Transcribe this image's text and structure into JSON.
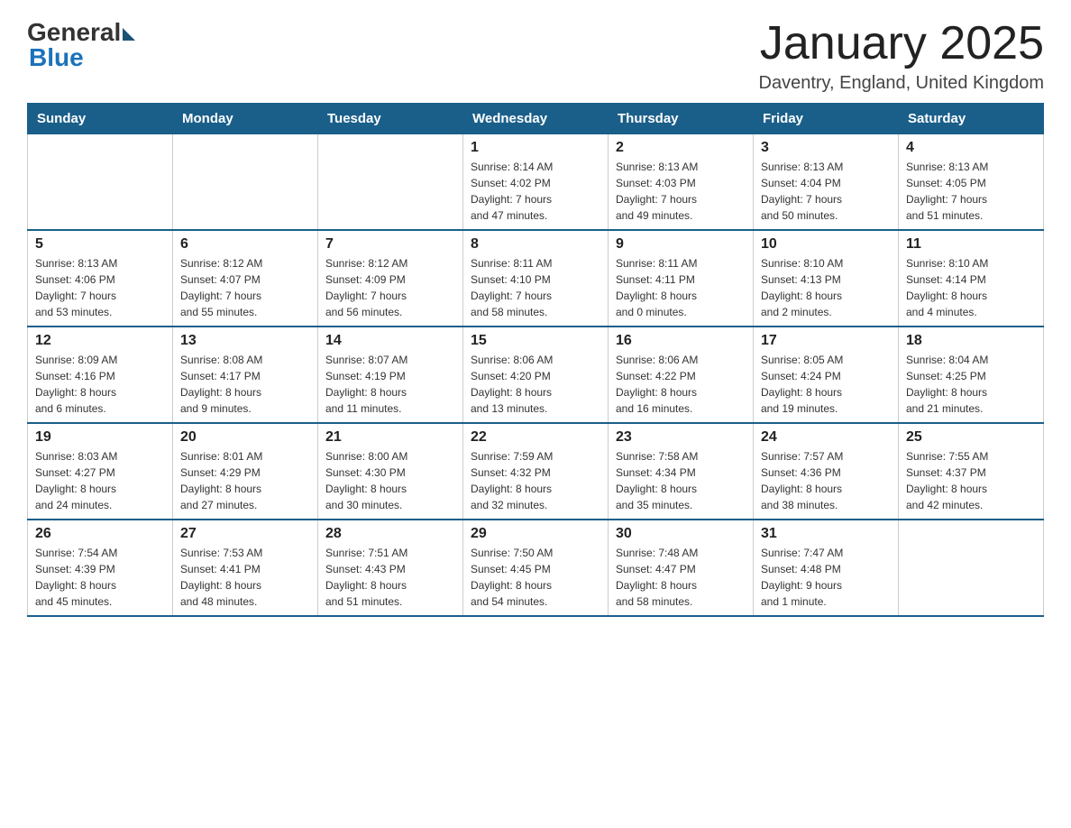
{
  "header": {
    "logo_general": "General",
    "logo_blue": "Blue",
    "title": "January 2025",
    "subtitle": "Daventry, England, United Kingdom"
  },
  "days_of_week": [
    "Sunday",
    "Monday",
    "Tuesday",
    "Wednesday",
    "Thursday",
    "Friday",
    "Saturday"
  ],
  "weeks": [
    {
      "days": [
        {
          "num": "",
          "info": ""
        },
        {
          "num": "",
          "info": ""
        },
        {
          "num": "",
          "info": ""
        },
        {
          "num": "1",
          "info": "Sunrise: 8:14 AM\nSunset: 4:02 PM\nDaylight: 7 hours\nand 47 minutes."
        },
        {
          "num": "2",
          "info": "Sunrise: 8:13 AM\nSunset: 4:03 PM\nDaylight: 7 hours\nand 49 minutes."
        },
        {
          "num": "3",
          "info": "Sunrise: 8:13 AM\nSunset: 4:04 PM\nDaylight: 7 hours\nand 50 minutes."
        },
        {
          "num": "4",
          "info": "Sunrise: 8:13 AM\nSunset: 4:05 PM\nDaylight: 7 hours\nand 51 minutes."
        }
      ]
    },
    {
      "days": [
        {
          "num": "5",
          "info": "Sunrise: 8:13 AM\nSunset: 4:06 PM\nDaylight: 7 hours\nand 53 minutes."
        },
        {
          "num": "6",
          "info": "Sunrise: 8:12 AM\nSunset: 4:07 PM\nDaylight: 7 hours\nand 55 minutes."
        },
        {
          "num": "7",
          "info": "Sunrise: 8:12 AM\nSunset: 4:09 PM\nDaylight: 7 hours\nand 56 minutes."
        },
        {
          "num": "8",
          "info": "Sunrise: 8:11 AM\nSunset: 4:10 PM\nDaylight: 7 hours\nand 58 minutes."
        },
        {
          "num": "9",
          "info": "Sunrise: 8:11 AM\nSunset: 4:11 PM\nDaylight: 8 hours\nand 0 minutes."
        },
        {
          "num": "10",
          "info": "Sunrise: 8:10 AM\nSunset: 4:13 PM\nDaylight: 8 hours\nand 2 minutes."
        },
        {
          "num": "11",
          "info": "Sunrise: 8:10 AM\nSunset: 4:14 PM\nDaylight: 8 hours\nand 4 minutes."
        }
      ]
    },
    {
      "days": [
        {
          "num": "12",
          "info": "Sunrise: 8:09 AM\nSunset: 4:16 PM\nDaylight: 8 hours\nand 6 minutes."
        },
        {
          "num": "13",
          "info": "Sunrise: 8:08 AM\nSunset: 4:17 PM\nDaylight: 8 hours\nand 9 minutes."
        },
        {
          "num": "14",
          "info": "Sunrise: 8:07 AM\nSunset: 4:19 PM\nDaylight: 8 hours\nand 11 minutes."
        },
        {
          "num": "15",
          "info": "Sunrise: 8:06 AM\nSunset: 4:20 PM\nDaylight: 8 hours\nand 13 minutes."
        },
        {
          "num": "16",
          "info": "Sunrise: 8:06 AM\nSunset: 4:22 PM\nDaylight: 8 hours\nand 16 minutes."
        },
        {
          "num": "17",
          "info": "Sunrise: 8:05 AM\nSunset: 4:24 PM\nDaylight: 8 hours\nand 19 minutes."
        },
        {
          "num": "18",
          "info": "Sunrise: 8:04 AM\nSunset: 4:25 PM\nDaylight: 8 hours\nand 21 minutes."
        }
      ]
    },
    {
      "days": [
        {
          "num": "19",
          "info": "Sunrise: 8:03 AM\nSunset: 4:27 PM\nDaylight: 8 hours\nand 24 minutes."
        },
        {
          "num": "20",
          "info": "Sunrise: 8:01 AM\nSunset: 4:29 PM\nDaylight: 8 hours\nand 27 minutes."
        },
        {
          "num": "21",
          "info": "Sunrise: 8:00 AM\nSunset: 4:30 PM\nDaylight: 8 hours\nand 30 minutes."
        },
        {
          "num": "22",
          "info": "Sunrise: 7:59 AM\nSunset: 4:32 PM\nDaylight: 8 hours\nand 32 minutes."
        },
        {
          "num": "23",
          "info": "Sunrise: 7:58 AM\nSunset: 4:34 PM\nDaylight: 8 hours\nand 35 minutes."
        },
        {
          "num": "24",
          "info": "Sunrise: 7:57 AM\nSunset: 4:36 PM\nDaylight: 8 hours\nand 38 minutes."
        },
        {
          "num": "25",
          "info": "Sunrise: 7:55 AM\nSunset: 4:37 PM\nDaylight: 8 hours\nand 42 minutes."
        }
      ]
    },
    {
      "days": [
        {
          "num": "26",
          "info": "Sunrise: 7:54 AM\nSunset: 4:39 PM\nDaylight: 8 hours\nand 45 minutes."
        },
        {
          "num": "27",
          "info": "Sunrise: 7:53 AM\nSunset: 4:41 PM\nDaylight: 8 hours\nand 48 minutes."
        },
        {
          "num": "28",
          "info": "Sunrise: 7:51 AM\nSunset: 4:43 PM\nDaylight: 8 hours\nand 51 minutes."
        },
        {
          "num": "29",
          "info": "Sunrise: 7:50 AM\nSunset: 4:45 PM\nDaylight: 8 hours\nand 54 minutes."
        },
        {
          "num": "30",
          "info": "Sunrise: 7:48 AM\nSunset: 4:47 PM\nDaylight: 8 hours\nand 58 minutes."
        },
        {
          "num": "31",
          "info": "Sunrise: 7:47 AM\nSunset: 4:48 PM\nDaylight: 9 hours\nand 1 minute."
        },
        {
          "num": "",
          "info": ""
        }
      ]
    }
  ]
}
